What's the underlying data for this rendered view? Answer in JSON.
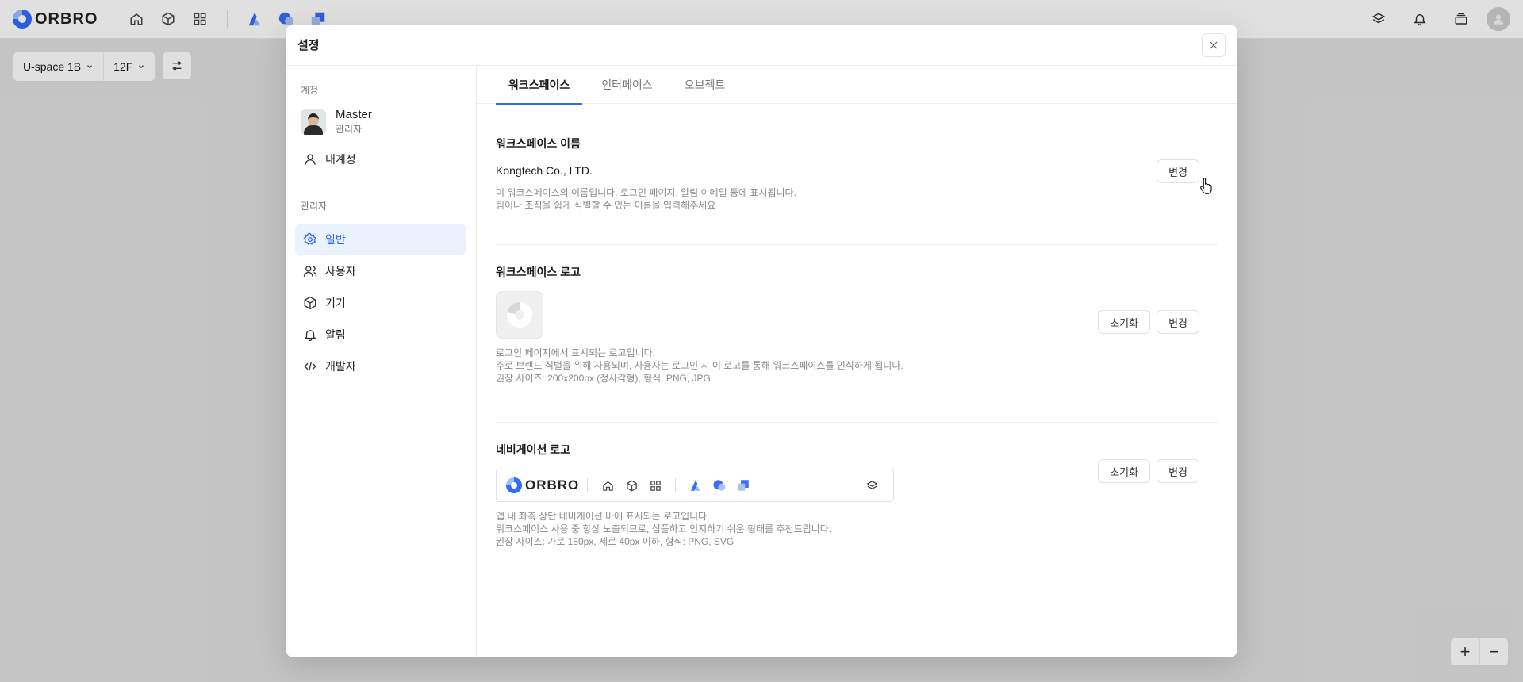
{
  "topnav": {
    "brand": "ORBRO",
    "icons": [
      "home-icon",
      "cube-icon",
      "grid-icon",
      "app-a-icon",
      "app-b-icon",
      "app-c-icon"
    ],
    "right_icons": [
      "layers-icon",
      "bell-icon",
      "stack-icon",
      "user-avatar-icon"
    ]
  },
  "toolbar": {
    "building": "U-space 1B",
    "floor": "12F"
  },
  "zoom": {
    "plus": "+",
    "minus": "−"
  },
  "modal": {
    "title": "설정"
  },
  "sidebar": {
    "account_section": "계정",
    "profile": {
      "name": "Master",
      "role": "관리자"
    },
    "my_account": "내계정",
    "admin_section": "관리자",
    "items": [
      {
        "label": "일반",
        "icon": "gear-icon",
        "active": true
      },
      {
        "label": "사용자",
        "icon": "users-icon",
        "active": false
      },
      {
        "label": "기기",
        "icon": "cube-icon",
        "active": false
      },
      {
        "label": "알림",
        "icon": "bell-icon",
        "active": false
      },
      {
        "label": "개발자",
        "icon": "code-icon",
        "active": false
      }
    ]
  },
  "tabs": [
    {
      "label": "워크스페이스",
      "active": true
    },
    {
      "label": "인터페이스",
      "active": false
    },
    {
      "label": "오브젝트",
      "active": false
    }
  ],
  "workspace_name": {
    "title": "워크스페이스 이름",
    "value": "Kongtech Co., LTD.",
    "desc1": "이 워크스페이스의 이름입니다. 로그인 페이지, 알림 이메일  등에 표시됩니다.",
    "desc2": "팀이나 조직을 쉽게 식별할 수 있는 이름을 입력해주세요",
    "change_label": "변경"
  },
  "workspace_logo": {
    "title": "워크스페이스 로고",
    "desc1": "로그인 페이지에서 표시되는 로고입니다.",
    "desc2": "주로 브랜드 식별을 위해 사용되며, 사용자는 로그인 시 이 로고를 통해 워크스페이스를 인식하게 됩니다.",
    "desc3": "권장 사이즈: 200x200px (정사각형), 형식: PNG, JPG",
    "reset_label": "초기화",
    "change_label": "변경"
  },
  "nav_logo": {
    "title": "네비게이션 로고",
    "brand": "ORBRO",
    "desc1": "앱 내 좌측 상단 네비게이션 바에 표시되는 로고입니다.",
    "desc2": "워크스페이스 사용 중 항상 노출되므로, 심플하고 인지하기 쉬운 형태를 추천드립니다.",
    "desc3": "권장 사이즈: 가로 180px, 세로 40px 이하, 형식: PNG, SVG",
    "reset_label": "초기화",
    "change_label": "변경"
  },
  "colors": {
    "accent": "#2f6bff",
    "active_bg": "#eaf2fd"
  }
}
